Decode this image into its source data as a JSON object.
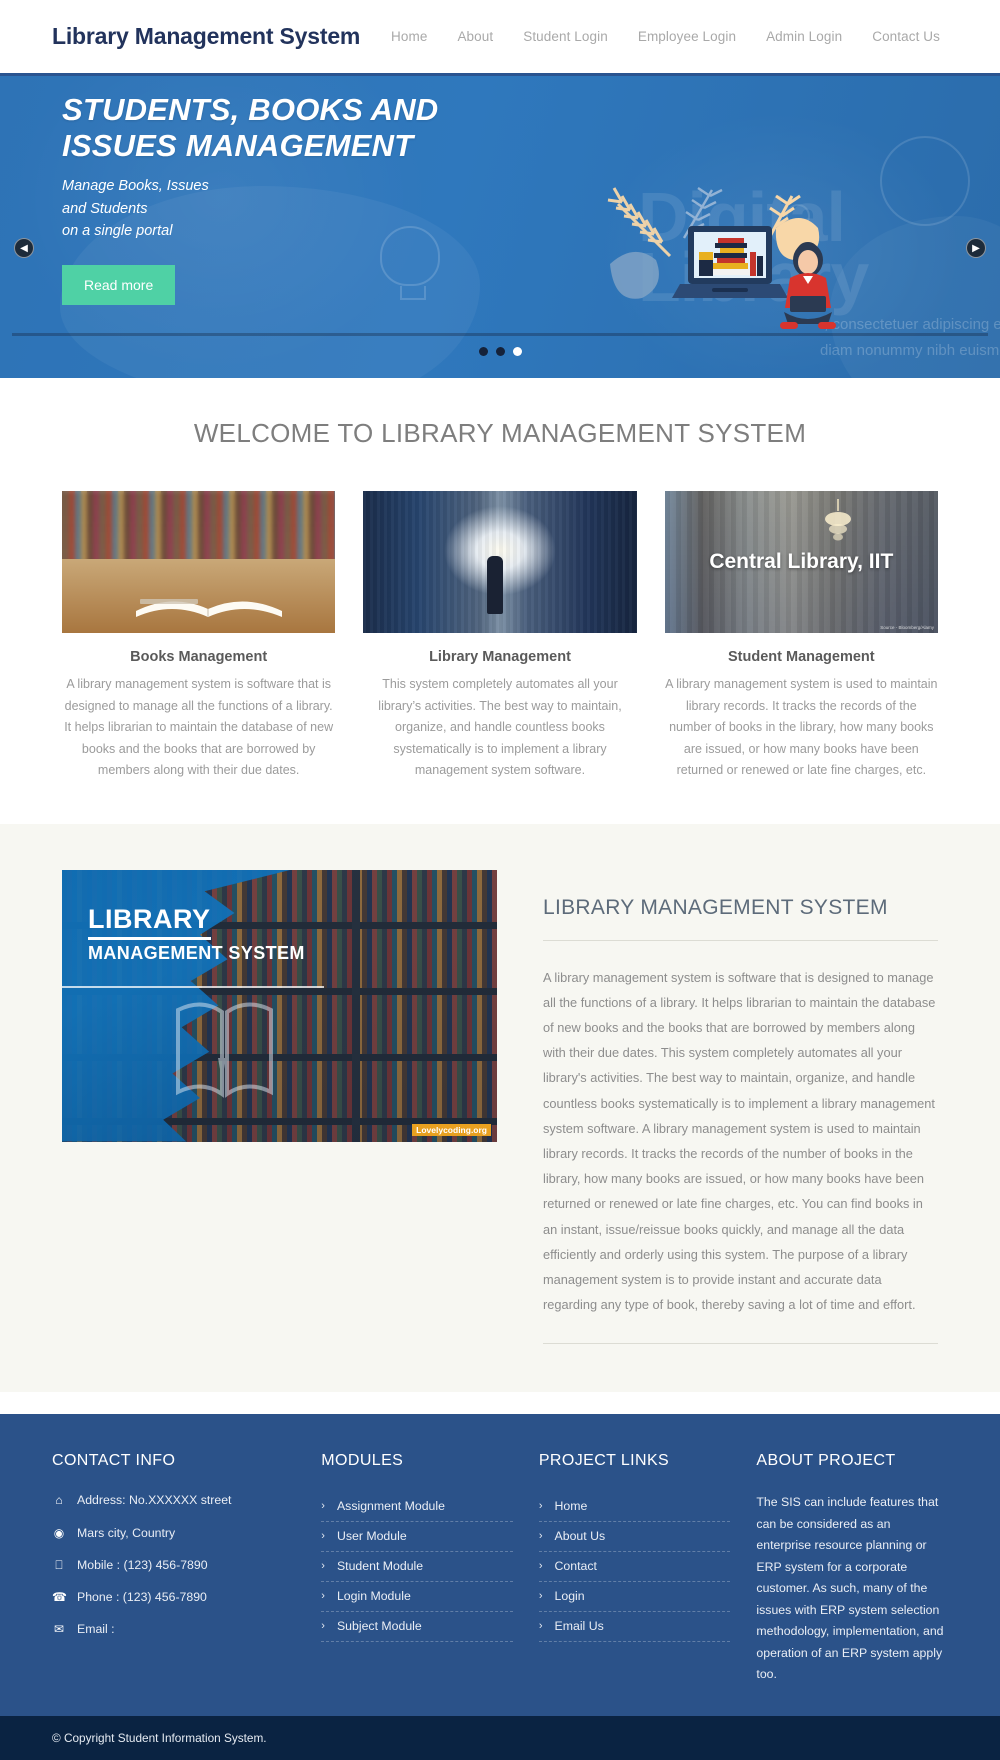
{
  "header": {
    "brand": "Library Management System",
    "nav": [
      {
        "label": "Home"
      },
      {
        "label": "About"
      },
      {
        "label": "Student Login"
      },
      {
        "label": "Employee Login"
      },
      {
        "label": "Admin Login"
      },
      {
        "label": "Contact Us"
      }
    ]
  },
  "hero": {
    "title": "STUDENTS, BOOKS AND ISSUES MANAGEMENT",
    "subtitle": "Manage Books, Issues\nand Students\non a single portal",
    "cta": "Read more",
    "ghost_word_line1": "Digital",
    "ghost_word_line2": "Library",
    "ghost_sub": "t, consectetuer adipiscing elit, sed diam nonummy nibh euismod tincidunt",
    "prev_icon": "◀",
    "next_icon": "▶",
    "slide_count": 3,
    "active_slide": 3
  },
  "welcome": {
    "heading": "WELCOME TO LIBRARY MANAGEMENT SYSTEM",
    "cards": [
      {
        "title": "Books Management",
        "text": "A library management system is software that is designed to manage all the functions of a library. It helps librarian to maintain the database of new books and the books that are borrowed by members along with their due dates."
      },
      {
        "title": "Library Management",
        "text": "This system completely automates all your library’s activities. The best way to maintain, organize, and handle countless books systematically is to implement a library management system software."
      },
      {
        "title": "Student Management",
        "text": "A library management system is used to maintain library records. It tracks the records of the number of books in the library, how many books are issued, or how many books have been returned or renewed or late fine charges, etc."
      }
    ],
    "card3_image_caption": "Central Library, IIT",
    "card3_image_source": "Source - Bloomberg/Alamy"
  },
  "detail": {
    "image_title_line1": "LIBRARY",
    "image_title_line2": "MANAGEMENT SYSTEM",
    "image_watermark": "Lovelycoding.org",
    "heading": "LIBRARY MANAGEMENT SYSTEM",
    "body": "A library management system is software that is designed to manage all the functions of a library. It helps librarian to maintain the database of new books and the books that are borrowed by members along with their due dates. This system completely automates all your library's activities. The best way to maintain, organize, and handle countless books systematically is to implement a library management system software. A library management system is used to maintain library records. It tracks the records of the number of books in the library, how many books are issued, or how many books have been returned or renewed or late fine charges, etc. You can find books in an instant, issue/reissue books quickly, and manage all the data efficiently and orderly using this system. The purpose of a library management system is to provide instant and accurate data regarding any type of book, thereby saving a lot of time and effort."
  },
  "footer": {
    "contact": {
      "title": "CONTACT INFO",
      "items": [
        {
          "icon": "home-icon",
          "glyph": "⌂",
          "text": "Address: No.XXXXXX street"
        },
        {
          "icon": "globe-icon",
          "glyph": "◉",
          "text": "Mars city, Country"
        },
        {
          "icon": "mobile-icon",
          "glyph": "⎕",
          "text": "Mobile : (123) 456-7890"
        },
        {
          "icon": "phone-icon",
          "glyph": "☎",
          "text": "Phone : (123) 456-7890"
        },
        {
          "icon": "envelope-icon",
          "glyph": "✉",
          "text": "Email :"
        }
      ]
    },
    "modules": {
      "title": "MODULES",
      "items": [
        {
          "label": "Assignment Module"
        },
        {
          "label": "User Module"
        },
        {
          "label": "Student Module"
        },
        {
          "label": "Login Module"
        },
        {
          "label": "Subject Module"
        }
      ]
    },
    "links": {
      "title": "PROJECT LINKS",
      "items": [
        {
          "label": "Home"
        },
        {
          "label": "About Us"
        },
        {
          "label": "Contact"
        },
        {
          "label": "Login"
        },
        {
          "label": "Email Us"
        }
      ]
    },
    "about": {
      "title": "ABOUT PROJECT",
      "text": "The SIS can include features that can be considered as an enterprise resource planning or ERP system for a corporate customer. As such, many of the issues with ERP system selection methodology, implementation, and operation of an ERP system apply too."
    },
    "chevron": "›",
    "copyright": "© Copyright Student Information System."
  },
  "colors": {
    "brand_navy": "#22335c",
    "hero_blue": "#2f74b5",
    "cta_green": "#4fd1a5",
    "footer_blue": "#2b5289",
    "copyright_navy": "#0a2342",
    "section_cream": "#f7f7f2"
  }
}
